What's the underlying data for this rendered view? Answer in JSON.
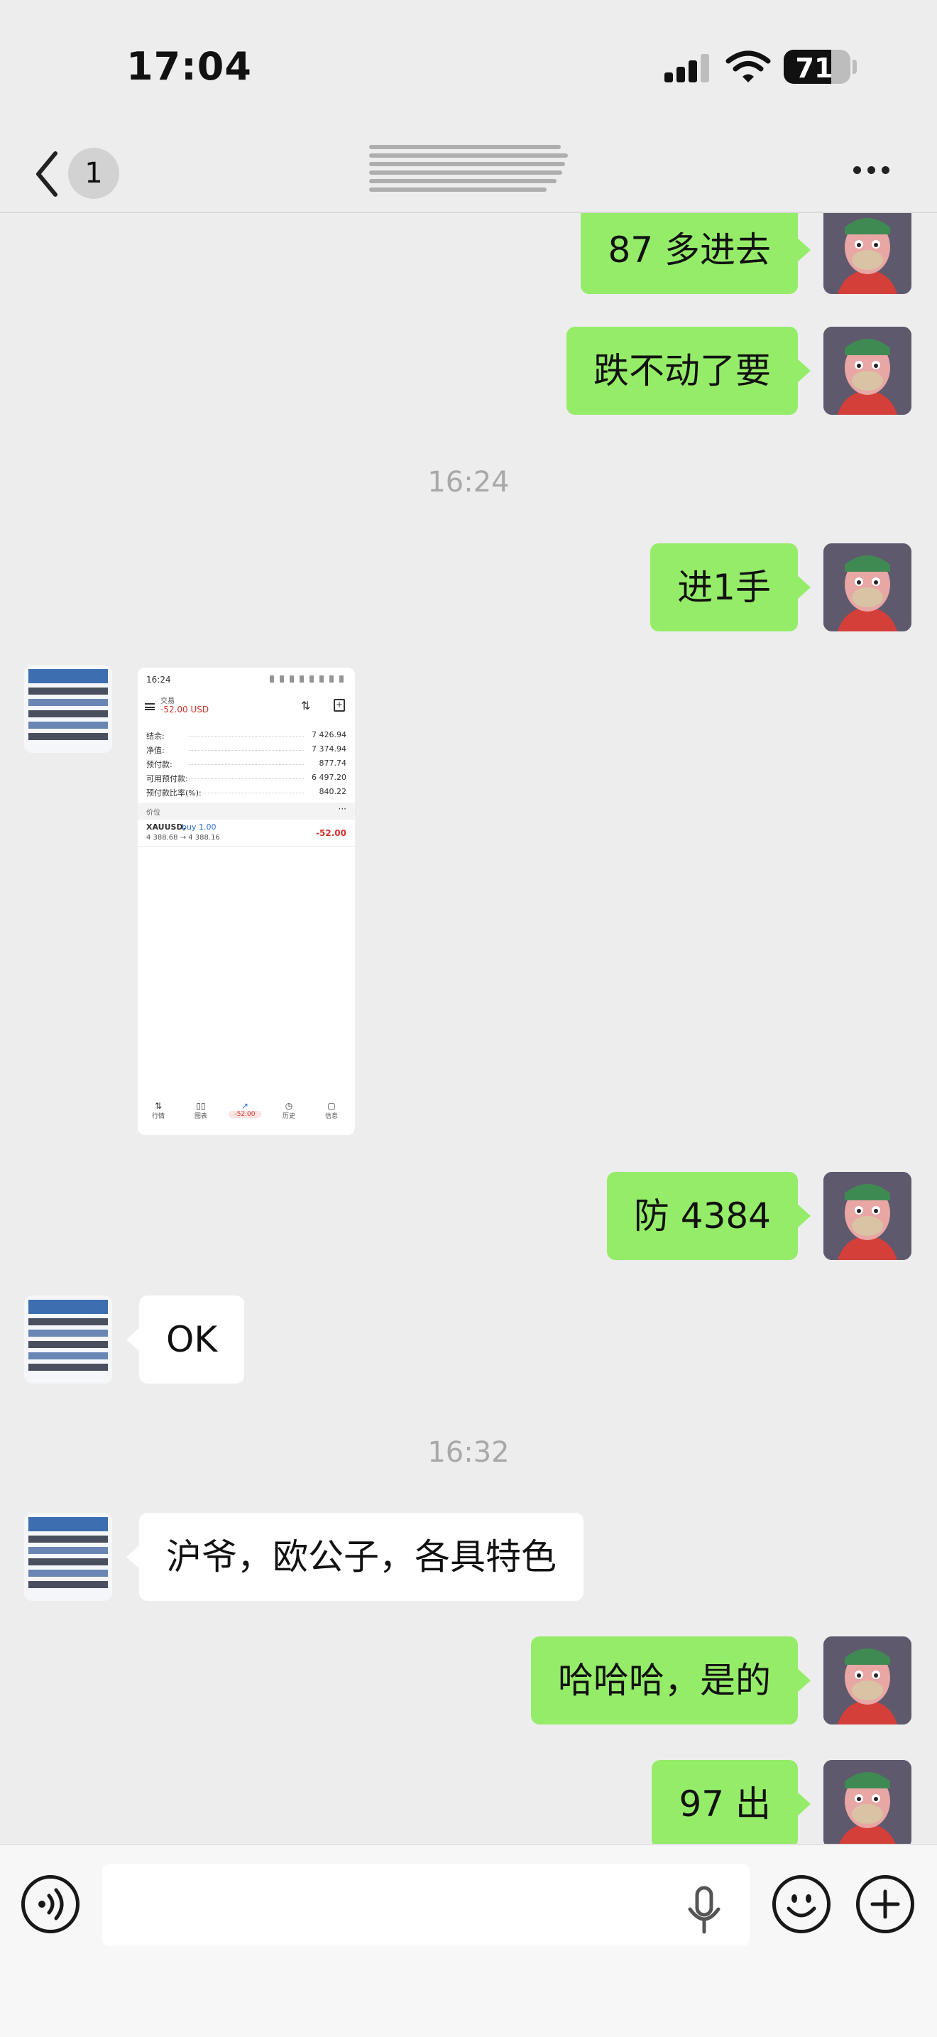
{
  "status_bar": {
    "time": "17:04",
    "battery_percent": "71",
    "battery_level": 0.71,
    "signal_bars": 3,
    "signal_total": 4,
    "icons": [
      "signal-icon",
      "wifi-icon",
      "battery-icon"
    ]
  },
  "header": {
    "back_icon": "chevron-left-icon",
    "unread_badge": "1",
    "more_icon": "more-dots-icon"
  },
  "messages": [
    {
      "sender": "me",
      "text": "87 多进去"
    },
    {
      "sender": "me",
      "text": "跌不动了要"
    },
    {
      "type": "timestamp",
      "text": "16:24"
    },
    {
      "sender": "me",
      "text": "进1手"
    },
    {
      "sender": "other",
      "type": "image"
    },
    {
      "sender": "me",
      "text": "防 4384"
    },
    {
      "sender": "other",
      "text": "OK"
    },
    {
      "type": "timestamp",
      "text": "16:32"
    },
    {
      "sender": "other",
      "text": "沪爷，欧公子，各具特色"
    },
    {
      "sender": "me",
      "text": "哈哈哈，是的"
    },
    {
      "sender": "me",
      "text": "97 出"
    }
  ],
  "screenshot": {
    "status_time": "16:24",
    "header_label": "交易",
    "header_value": "-52.00 USD",
    "rows": [
      {
        "label": "结余:",
        "value": "7 426.94"
      },
      {
        "label": "净值:",
        "value": "7 374.94"
      },
      {
        "label": "预付款:",
        "value": "877.74"
      },
      {
        "label": "可用预付款:",
        "value": "6 497.20"
      },
      {
        "label": "预付款比率(%):",
        "value": "840.22"
      }
    ],
    "positions_label": "价位",
    "position": {
      "symbol": "XAUUSD,",
      "side": "buy 1.00",
      "prices": "4 388.68 → 4 388.16",
      "profit": "-52.00"
    },
    "nav": [
      {
        "label": "行情",
        "icon": "quotes-icon"
      },
      {
        "label": "图表",
        "icon": "chart-icon"
      },
      {
        "label": "-52.00",
        "icon": "trade-icon"
      },
      {
        "label": "历史",
        "icon": "history-icon"
      },
      {
        "label": "信息",
        "icon": "messages-icon"
      }
    ]
  },
  "input_bar": {
    "voice_icon": "voice-icon",
    "mic_icon": "microphone-icon",
    "emoji_icon": "emoji-icon",
    "plus_icon": "plus-icon"
  },
  "colors": {
    "background": "#ededed",
    "my_bubble": "#95ec69",
    "other_bubble": "#ffffff",
    "timestamp": "#a8a8a8",
    "loss_red": "#d0342c"
  }
}
